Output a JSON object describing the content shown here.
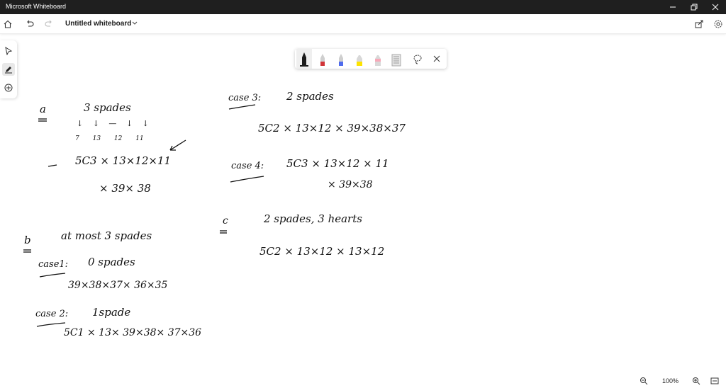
{
  "window": {
    "title": "Microsoft Whiteboard"
  },
  "toolbar": {
    "doc_title": "Untitled whiteboard"
  },
  "icons": {
    "home": "home-icon",
    "undo": "undo-icon",
    "redo": "redo-icon",
    "share": "share-icon",
    "settings": "gear-icon",
    "select": "pointer-icon",
    "ink": "pen-icon",
    "create": "add-icon"
  },
  "pen_tray": {
    "tools": [
      {
        "name": "black-pen",
        "color": "#1b1b1b"
      },
      {
        "name": "red-pen",
        "color": "#d13438"
      },
      {
        "name": "blue-pen",
        "color": "#4f6bed"
      },
      {
        "name": "yellow-highlighter",
        "color": "#fde300"
      },
      {
        "name": "pink-highlighter",
        "color": "#f7a8b8"
      },
      {
        "name": "eraser",
        "color": "#bdbdbd"
      }
    ]
  },
  "zoom": {
    "value": "100%"
  },
  "ink": {
    "a_label": "a",
    "a_title": "3 spades",
    "a_marks1": "↓ ↓ — ↓ ↓",
    "a_marks2": "7 13 12 11",
    "a_expr1": "5C3 × 13×12×11",
    "a_expr2": "× 39× 38",
    "b_label": "b",
    "b_title": "at most 3 spades",
    "case1_label": "case1:",
    "case1_title": "0 spades",
    "case1_expr": "39×38×37× 36×35",
    "case2_label": "case 2:",
    "case2_title": "1spade",
    "case2_expr": "5C1 × 13× 39×38× 37×36",
    "case3_label": "case 3:",
    "case3_title": "2 spades",
    "case3_expr": "5C2 × 13×12 × 39×38×37",
    "case4_label": "case 4:",
    "case4_expr1": "5C3 × 13×12 × 11",
    "case4_expr2": "× 39×38",
    "c_label": "c",
    "c_title": "2 spades, 3 hearts",
    "c_expr": "5C2 × 13×12 × 13×12"
  }
}
